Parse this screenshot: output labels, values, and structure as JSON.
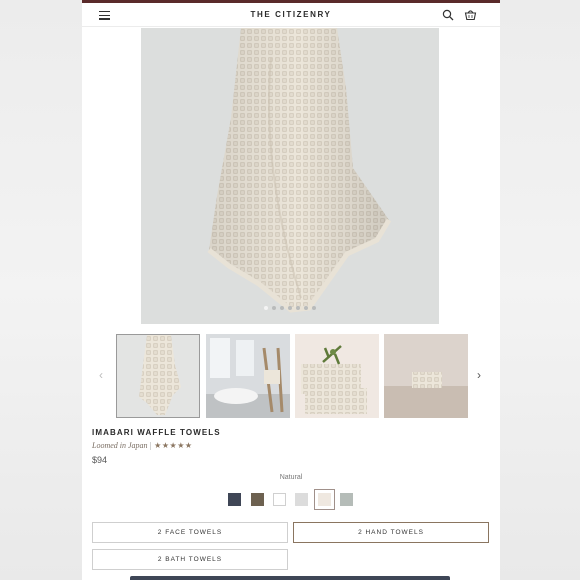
{
  "header": {
    "brand": "THE CITIZENRY"
  },
  "gallery": {
    "dot_count": 7,
    "active_dot": 0
  },
  "product": {
    "title": "IMABARI WAFFLE TOWELS",
    "origin": "Loomed in Japan",
    "rating": 4.5,
    "stars_text": "★★★★★",
    "price": "$94"
  },
  "color": {
    "label": "Natural",
    "swatches": [
      "#3f4656",
      "#6d6150",
      "#ffffff",
      "#dcdcdc",
      "#efe8e0",
      "#b5bcb8"
    ],
    "selected_index": 4
  },
  "sizes": {
    "options": [
      "2 FACE TOWELS",
      "2 HAND TOWELS",
      "2 BATH TOWELS"
    ],
    "selected_index": 1
  },
  "colors": {
    "accent": "#8a7560",
    "topline": "#5a2a2a"
  }
}
